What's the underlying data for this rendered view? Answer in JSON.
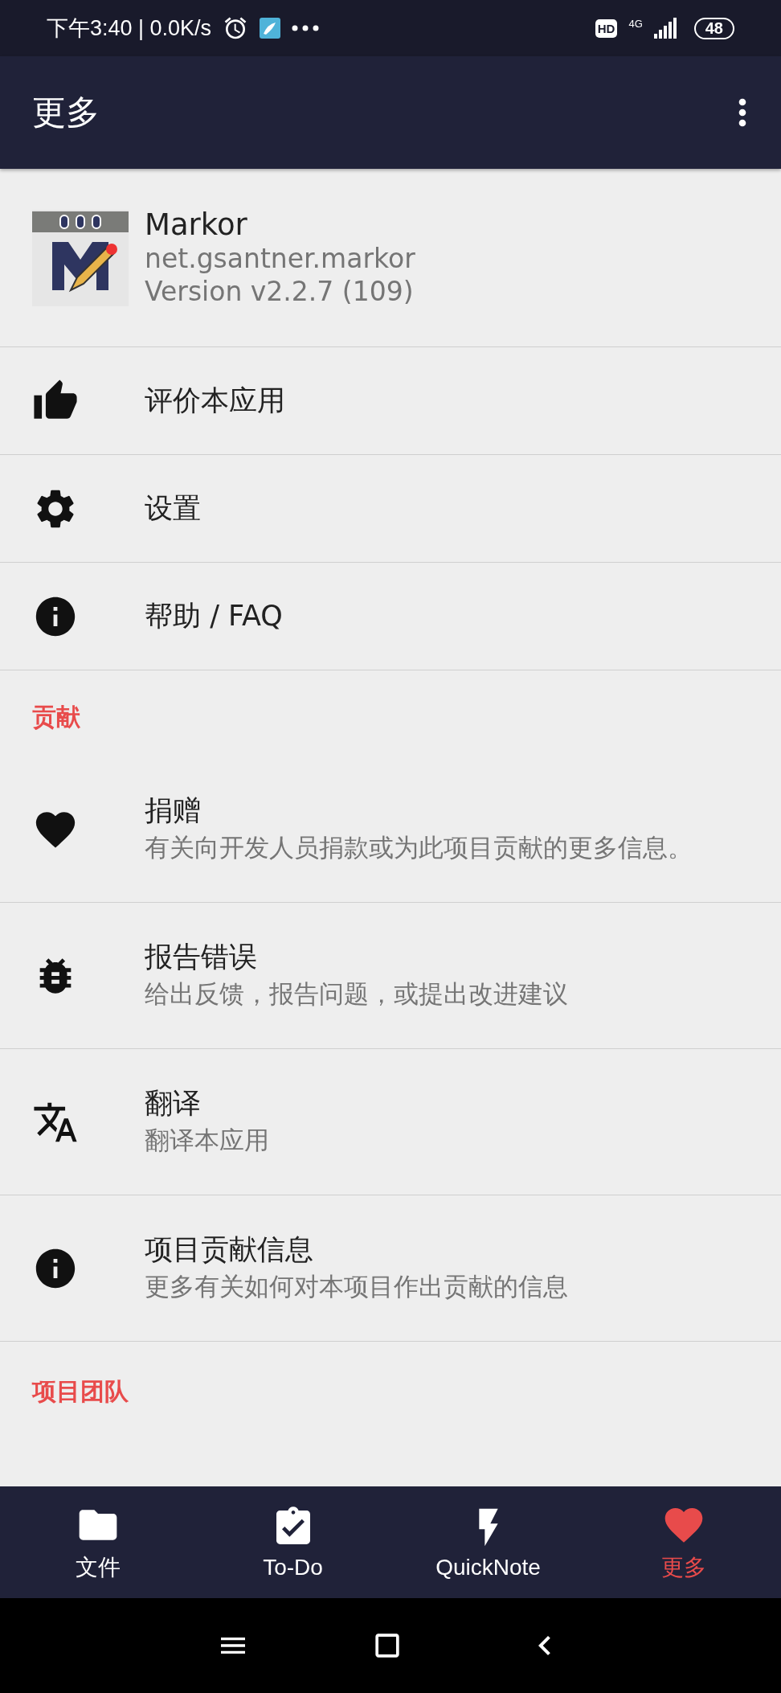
{
  "status_bar": {
    "time": "下午3:40 | 0.0K/s",
    "hd": "HD",
    "network": "4G",
    "battery": "48"
  },
  "app_bar": {
    "title": "更多"
  },
  "app_info": {
    "name": "Markor",
    "package": "net.gsantner.markor",
    "version": "Version v2.2.7 (109)"
  },
  "entries": [
    {
      "kind": "row",
      "title": "评价本应用"
    },
    {
      "kind": "row",
      "title": "设置"
    },
    {
      "kind": "row",
      "title": "帮助 / FAQ"
    },
    {
      "kind": "header",
      "title": "贡献"
    },
    {
      "kind": "row",
      "title": "捐赠",
      "subtitle": "有关向开发人员捐款或为此项目贡献的更多信息。"
    },
    {
      "kind": "row",
      "title": "报告错误",
      "subtitle": "给出反馈，报告问题，或提出改进建议"
    },
    {
      "kind": "row",
      "title": "翻译",
      "subtitle": "翻译本应用"
    },
    {
      "kind": "row",
      "title": "项目贡献信息",
      "subtitle": "更多有关如何对本项目作出贡献的信息"
    },
    {
      "kind": "header",
      "title": "项目团队"
    }
  ],
  "bottom_nav": [
    {
      "label": "文件",
      "selected": false
    },
    {
      "label": "To-Do",
      "selected": false
    },
    {
      "label": "QuickNote",
      "selected": false
    },
    {
      "label": "更多",
      "selected": true
    }
  ]
}
